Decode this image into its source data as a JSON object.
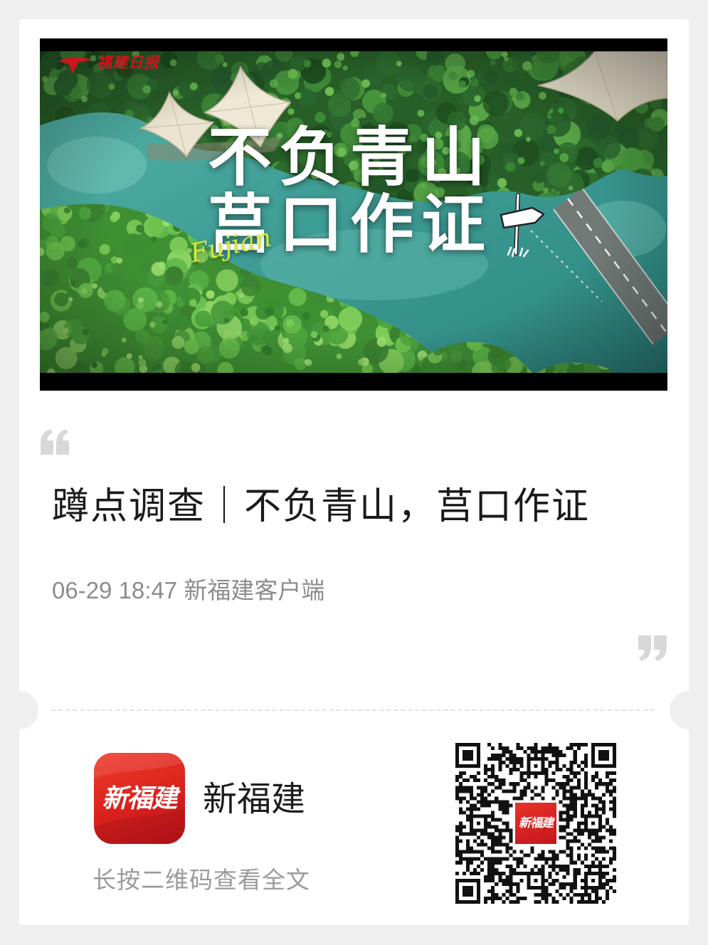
{
  "cover": {
    "logo_text": "福建日报",
    "headline": [
      "不负青山",
      "莒口作证"
    ],
    "script_text": "Fujian"
  },
  "article": {
    "title": "蹲点调查｜不负青山，莒口作证",
    "date": "06-29",
    "time": "18:47",
    "source": "新福建客户端"
  },
  "footer": {
    "app_icon_text": "新福建",
    "app_name": "新福建",
    "hint": "长按二维码查看全文",
    "qr_logo_text": "新福建"
  },
  "colors": {
    "brand_red": "#d7281f",
    "logo_red": "#c9161d",
    "title_text": "#1a1a1a",
    "meta_text": "#8c8c8c",
    "hint_text": "#9b9b9b",
    "quote_mark": "#d8d8d8",
    "headline_text": "#ffffff",
    "script_text": "#d4e83c",
    "page_background": "#efefef",
    "card_background": "#ffffff"
  }
}
